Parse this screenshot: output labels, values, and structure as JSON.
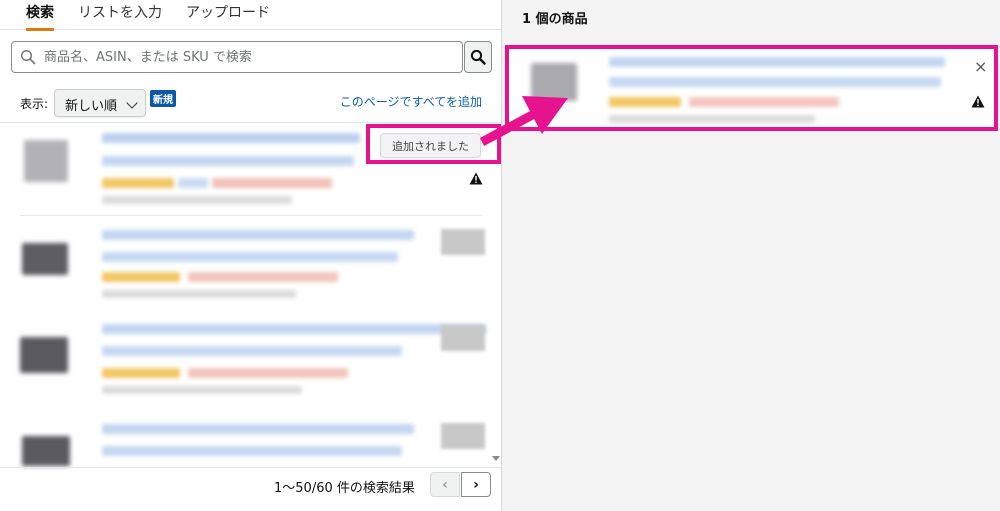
{
  "tabs": [
    {
      "label": "検索",
      "active": true
    },
    {
      "label": "リストを入力",
      "active": false
    },
    {
      "label": "アップロード",
      "active": false
    }
  ],
  "search": {
    "placeholder": "商品名、ASIN、または SKU で検索",
    "value": ""
  },
  "sort": {
    "label": "表示:",
    "selected": "新しい順",
    "badge": "新規",
    "add_all_link": "このページですべてを追加"
  },
  "results": {
    "first_item_button": "追加されました"
  },
  "pagination": {
    "count_text": "1〜50/60 件の検索結果",
    "prev": "‹",
    "next": "›"
  },
  "selected_panel": {
    "title": "1 個の商品",
    "close": "×"
  },
  "colors": {
    "highlight": "#e5138d",
    "link": "#0a5ea8",
    "badge": "#0a58a6",
    "tab_underline": "#e47911"
  }
}
